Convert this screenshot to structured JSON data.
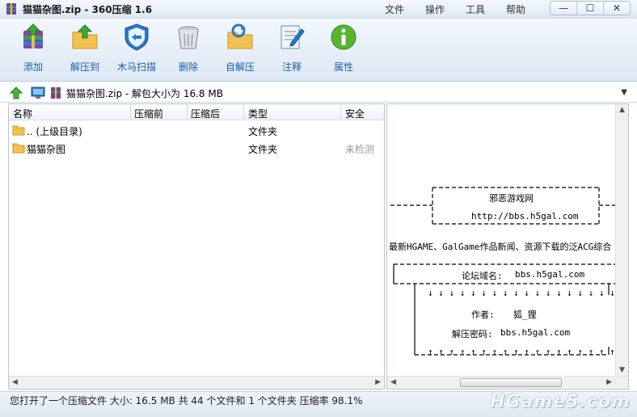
{
  "window": {
    "title": "猫猫杂图.zip - 360压缩 1.6",
    "menus": [
      "文件",
      "操作",
      "工具",
      "帮助"
    ],
    "controls": {
      "minimize": "—",
      "maximize": "☐",
      "close": "✕"
    }
  },
  "toolbar": {
    "add": "添加",
    "extract_to": "解压到",
    "trojan_scan": "木马扫描",
    "delete": "删除",
    "self_extract": "自解压",
    "comment": "注释",
    "properties": "属性"
  },
  "address": {
    "text": "猫猫杂图.zip - 解包大小为 16.8 MB"
  },
  "filelist": {
    "columns": [
      "名称",
      "压缩前",
      "压缩后",
      "类型",
      "安全"
    ],
    "rows": [
      {
        "name": ".. (上级目录)",
        "before": "",
        "after": "",
        "type": "文件夹",
        "safe": ""
      },
      {
        "name": "猫猫杂图",
        "before": "",
        "after": "",
        "type": "文件夹",
        "safe": "未检测"
      }
    ]
  },
  "comment": {
    "site_name": "邪恶游戏网",
    "site_url": "http://bbs.h5gal.com",
    "slogan": "最新HGAME、GalGame作品新闻、资源下载的泛ACG综合",
    "forum_label": "论坛域名:",
    "forum_value": "bbs.h5gal.com",
    "author_label": "作者:",
    "author_value": "狐_狸",
    "password_label": "解压密码:",
    "password_value": "bbs.h5gal.com"
  },
  "status": {
    "text": "您打开了一个压缩文件 大小: 16.5 MB 共 44 个文件和 1 个文件夹 压缩率 98.1%",
    "watermark": "HGame5.com"
  },
  "colors": {
    "toolbar_label": "#1d5fa8",
    "folder": "#f2c14e"
  }
}
